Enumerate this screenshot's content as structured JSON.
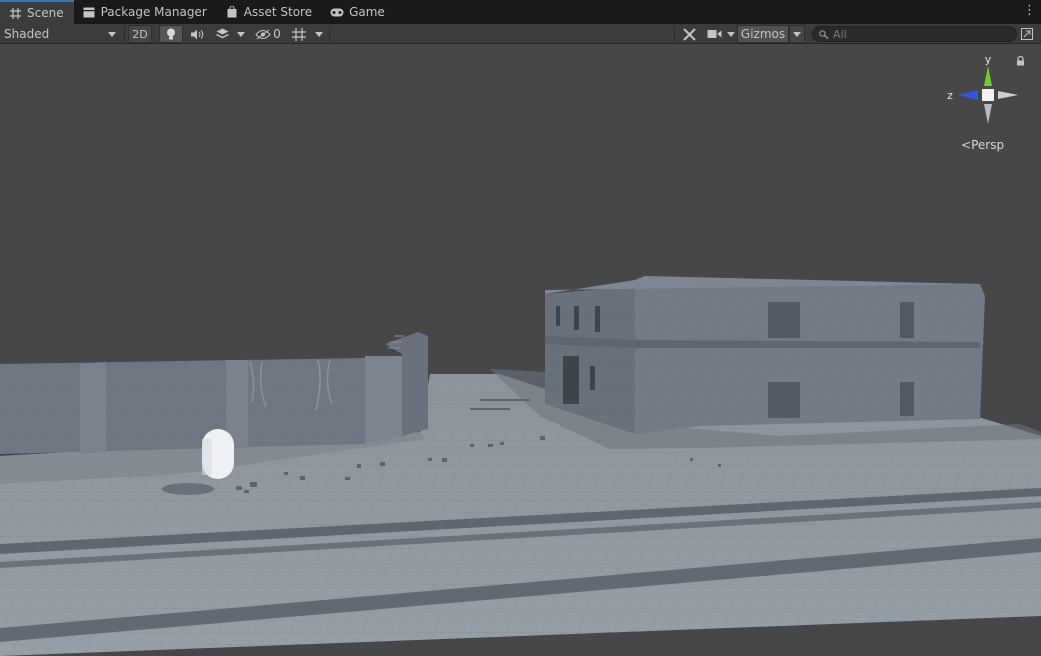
{
  "tabs": [
    {
      "label": "Scene",
      "icon": "grid-icon",
      "active": true
    },
    {
      "label": "Package Manager",
      "icon": "package-icon",
      "active": false
    },
    {
      "label": "Asset Store",
      "icon": "store-bag-icon",
      "active": false
    },
    {
      "label": "Game",
      "icon": "gamepad-icon",
      "active": false
    }
  ],
  "toolbar": {
    "draw_mode": "Shaded",
    "mode_2d": "2D",
    "hidden_count": "0",
    "gizmos_label": "Gizmos",
    "search_placeholder": "All"
  },
  "orientation_gizmo": {
    "y_label": "y",
    "z_label": "z",
    "projection_label": "Persp",
    "colors": {
      "y": "#6ccf2d",
      "z": "#3254e8",
      "x": "#cfcfcf"
    }
  },
  "colors": {
    "tab_accent": "#3a79bb",
    "viewport_bg": "#474747",
    "ground": "#8c929a",
    "walls": "#727985"
  }
}
